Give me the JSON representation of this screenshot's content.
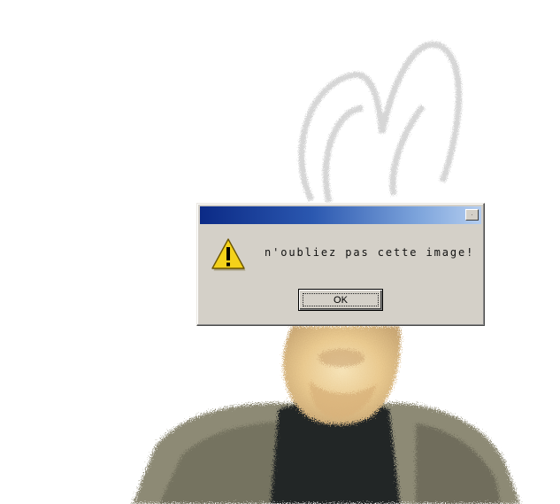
{
  "dialog": {
    "title": "",
    "message": "n'oubliez pas cette image!",
    "ok_label": "OK",
    "close_symbol": "×",
    "icon": "warning-icon",
    "colors": {
      "title_gradient_start": "#0b2a86",
      "title_gradient_end": "#b4cdef",
      "face": "#d4d0c8",
      "warning_yellow": "#f4d21a"
    }
  },
  "background_image": {
    "subject": "pixelated portrait of a person whose face is covered by a warning dialog"
  }
}
